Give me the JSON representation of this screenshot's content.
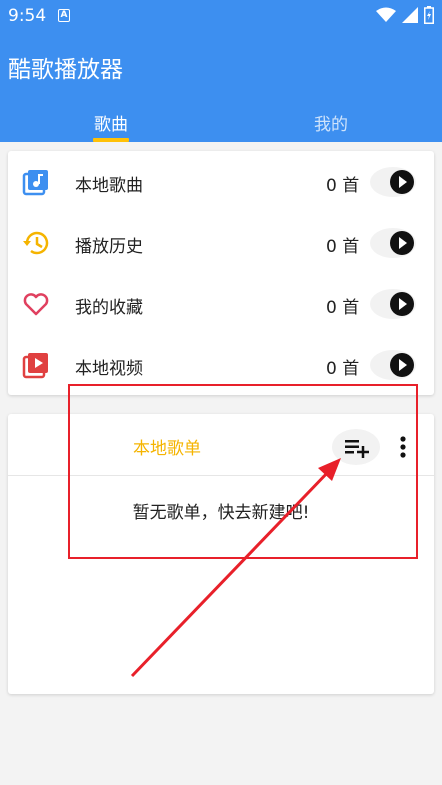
{
  "status_bar": {
    "time": "9:54",
    "notification_glyph": "A"
  },
  "app": {
    "title": "酷歌播放器",
    "tabs": [
      {
        "label": "歌曲",
        "active": true
      },
      {
        "label": "我的",
        "active": false
      }
    ]
  },
  "library": {
    "items": [
      {
        "label": "本地歌曲",
        "count": "0 首",
        "icon": "music-note-icon",
        "color": "#3d8ff0"
      },
      {
        "label": "播放历史",
        "count": "0 首",
        "icon": "history-icon",
        "color": "#f5b400"
      },
      {
        "label": "我的收藏",
        "count": "0 首",
        "icon": "heart-icon",
        "color": "#e0405f"
      },
      {
        "label": "本地视频",
        "count": "0 首",
        "icon": "video-icon",
        "color": "#e04040"
      }
    ]
  },
  "playlists": {
    "title": "本地歌单",
    "empty_text": "暂无歌单，快去新建吧!"
  },
  "colors": {
    "primary": "#3d8ff0",
    "accent": "#ffc107",
    "annotation": "#e8202a"
  }
}
